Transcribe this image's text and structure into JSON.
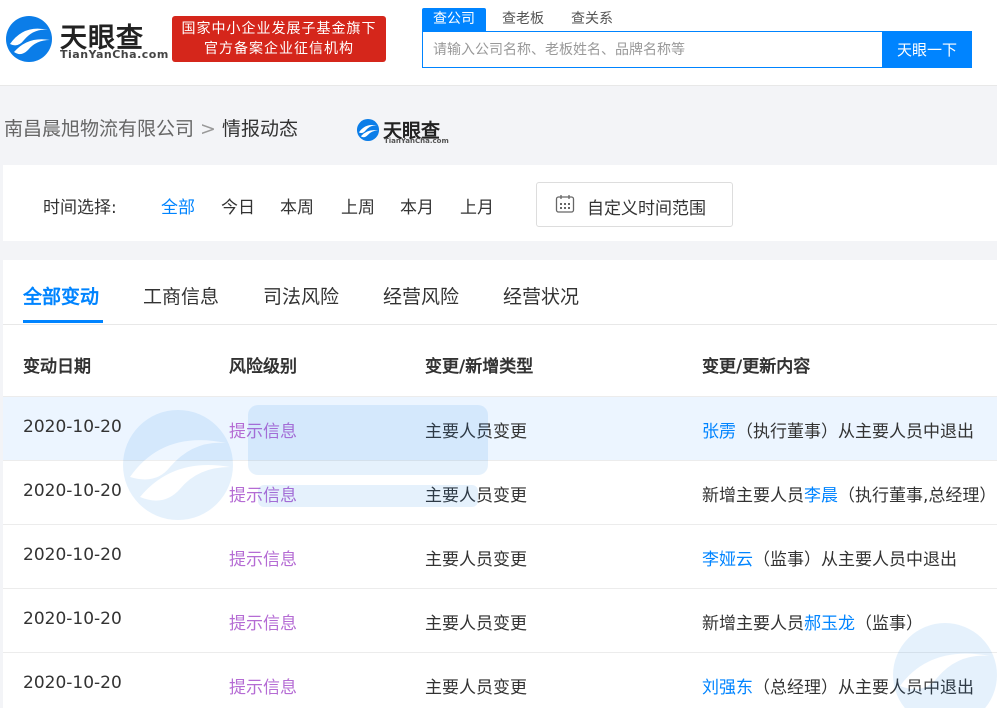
{
  "header": {
    "logo_cn": "天眼查",
    "logo_en": "TianYanCha.com",
    "banner_line1": "国家中小企业发展子基金旗下",
    "banner_line2": "官方备案企业征信机构",
    "search_tabs": [
      "查公司",
      "查老板",
      "查关系"
    ],
    "search_placeholder": "请输入公司名称、老板姓名、品牌名称等",
    "search_button": "天眼一下"
  },
  "breadcrumb": {
    "company": "南昌晨旭物流有限公司",
    "separator": ">",
    "current": "情报动态"
  },
  "small_logo": {
    "cn": "天眼查",
    "en": "TianYanCha.com"
  },
  "filter": {
    "label": "时间选择:",
    "options": [
      "全部",
      "今日",
      "本周",
      "上周",
      "本月",
      "上月"
    ],
    "selected": "全部",
    "custom_range": "自定义时间范围"
  },
  "tabs": [
    "全部变动",
    "工商信息",
    "司法风险",
    "经营风险",
    "经营状况"
  ],
  "active_tab": "全部变动",
  "table": {
    "headers": [
      "变动日期",
      "风险级别",
      "变更/新增类型",
      "变更/更新内容"
    ],
    "rows": [
      {
        "date": "2020-10-20",
        "risk": "提示信息",
        "type": "主要人员变更",
        "pre": "",
        "name": "张雳",
        "post": "（执行董事）从主要人员中退出"
      },
      {
        "date": "2020-10-20",
        "risk": "提示信息",
        "type": "主要人员变更",
        "pre": "新增主要人员",
        "name": "李晨",
        "post": "（执行董事,总经理）"
      },
      {
        "date": "2020-10-20",
        "risk": "提示信息",
        "type": "主要人员变更",
        "pre": "",
        "name": "李娅云",
        "post": "（监事）从主要人员中退出"
      },
      {
        "date": "2020-10-20",
        "risk": "提示信息",
        "type": "主要人员变更",
        "pre": "新增主要人员",
        "name": "郝玉龙",
        "post": "（监事）"
      },
      {
        "date": "2020-10-20",
        "risk": "提示信息",
        "type": "主要人员变更",
        "pre": "",
        "name": "刘强东",
        "post": "（总经理）从主要人员中退出"
      }
    ]
  },
  "colors": {
    "accent": "#0084ff",
    "banner": "#d5261b",
    "risk": "#b56cd4",
    "highlight_row": "#ecf5ff"
  }
}
